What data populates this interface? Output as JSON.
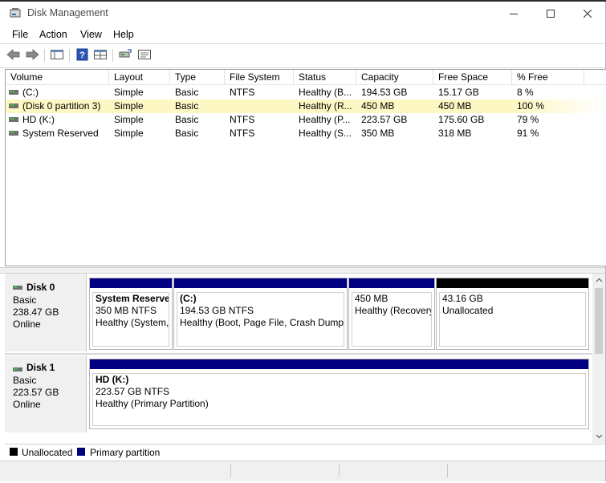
{
  "window": {
    "title": "Disk Management",
    "app_icon": "disk-management-icon"
  },
  "menu": [
    "File",
    "Action",
    "View",
    "Help"
  ],
  "toolbar": {
    "buttons": [
      {
        "name": "back-button",
        "icon": "arrow-left-icon"
      },
      {
        "name": "forward-button",
        "icon": "arrow-right-icon"
      },
      {
        "name": "show-hide-console-tree-button",
        "icon": "console-tree-icon"
      },
      {
        "name": "help-button",
        "icon": "help-icon"
      },
      {
        "name": "view-button",
        "icon": "view-pane-icon"
      },
      {
        "name": "connect-drive-button",
        "icon": "drive-connect-icon"
      },
      {
        "name": "properties-button",
        "icon": "properties-icon"
      }
    ]
  },
  "volume_list": {
    "columns": [
      "Volume",
      "Layout",
      "Type",
      "File System",
      "Status",
      "Capacity",
      "Free Space",
      "% Free"
    ],
    "rows": [
      {
        "volume": "(C:)",
        "layout": "Simple",
        "type": "Basic",
        "fs": "NTFS",
        "status": "Healthy (B...",
        "capacity": "194.53 GB",
        "free": "15.17 GB",
        "pct": "8 %",
        "selected": false
      },
      {
        "volume": "(Disk 0 partition 3)",
        "layout": "Simple",
        "type": "Basic",
        "fs": "",
        "status": "Healthy (R...",
        "capacity": "450 MB",
        "free": "450 MB",
        "pct": "100 %",
        "selected": true
      },
      {
        "volume": "HD (K:)",
        "layout": "Simple",
        "type": "Basic",
        "fs": "NTFS",
        "status": "Healthy (P...",
        "capacity": "223.57 GB",
        "free": "175.60 GB",
        "pct": "79 %",
        "selected": false
      },
      {
        "volume": "System Reserved",
        "layout": "Simple",
        "type": "Basic",
        "fs": "NTFS",
        "status": "Healthy (S...",
        "capacity": "350 MB",
        "free": "318 MB",
        "pct": "91 %",
        "selected": false
      }
    ]
  },
  "disks": [
    {
      "name": "Disk 0",
      "type": "Basic",
      "size": "238.47 GB",
      "status": "Online",
      "partitions": [
        {
          "title": "System Reserve",
          "size_line": "350 MB NTFS",
          "status_line": "Healthy (System,",
          "kind": "primary"
        },
        {
          "title": "(C:)",
          "size_line": "194.53 GB NTFS",
          "status_line": "Healthy (Boot, Page File, Crash Dump,",
          "kind": "primary"
        },
        {
          "title": "",
          "size_line": "450 MB",
          "status_line": "Healthy (Recovery",
          "kind": "primary"
        },
        {
          "title": "",
          "size_line": "43.16 GB",
          "status_line": "Unallocated",
          "kind": "unallocated"
        }
      ]
    },
    {
      "name": "Disk 1",
      "type": "Basic",
      "size": "223.57 GB",
      "status": "Online",
      "partitions": [
        {
          "title": "HD  (K:)",
          "size_line": "223.57 GB NTFS",
          "status_line": "Healthy (Primary Partition)",
          "kind": "primary"
        }
      ]
    }
  ],
  "legend": [
    {
      "label": "Unallocated",
      "color": "#000000"
    },
    {
      "label": "Primary partition",
      "color": "#00007f"
    }
  ],
  "colors": {
    "primary": "#000080",
    "unallocated": "#000000",
    "selection": "#fdf7c4"
  }
}
